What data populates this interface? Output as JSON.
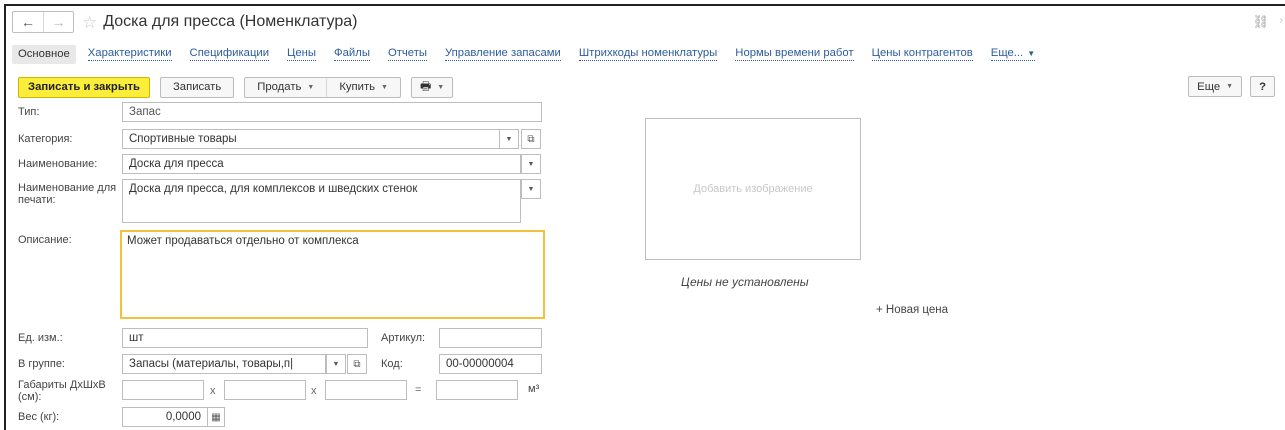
{
  "window": {
    "title": "Доска для пресса (Номенклатура)"
  },
  "nav": {
    "back": "←",
    "forward": "→",
    "star": "☆",
    "link": "⛓",
    "more": "›"
  },
  "tabs": [
    {
      "label": "Основное"
    },
    {
      "label": "Характеристики"
    },
    {
      "label": "Спецификации"
    },
    {
      "label": "Цены"
    },
    {
      "label": "Файлы"
    },
    {
      "label": "Отчеты"
    },
    {
      "label": "Управление запасами"
    },
    {
      "label": "Штрихкоды номенклатуры"
    },
    {
      "label": "Нормы времени работ"
    },
    {
      "label": "Цены контрагентов"
    },
    {
      "label": "Еще..."
    }
  ],
  "toolbar": {
    "save_close": "Записать и закрыть",
    "save": "Записать",
    "sell": "Продать",
    "buy": "Купить",
    "print_icon": "🖶",
    "more": "Еще",
    "help": "?"
  },
  "form": {
    "type_label": "Тип:",
    "type_value": "Запас",
    "category_label": "Категория:",
    "category_value": "Спортивные товары",
    "name_label": "Наименование:",
    "name_value": "Доска для пресса",
    "print_name_label": "Наименование для печати:",
    "print_name_value": "Доска для пресса, для комплексов и шведских стенок",
    "description_label": "Описание:",
    "description_value": "Может продаваться отдельно от комплекса",
    "unit_label": "Ед. изм.:",
    "unit_value": "шт",
    "sku_label": "Артикул:",
    "sku_value": "",
    "group_label": "В группе:",
    "group_value": "Запасы (материалы, товары,п|",
    "code_label": "Код:",
    "code_value": "00-00000004",
    "dims_label": "Габариты ДхШхВ (см):",
    "dims_x1": "x",
    "dims_x2": "x",
    "dims_eq": "=",
    "dims_unit": "м³",
    "weight_label": "Вес (кг):",
    "weight_value": "0,0000"
  },
  "image": {
    "placeholder": "Добавить изображение"
  },
  "prices": {
    "none": "Цены не установлены",
    "new": "+ Новая цена"
  }
}
